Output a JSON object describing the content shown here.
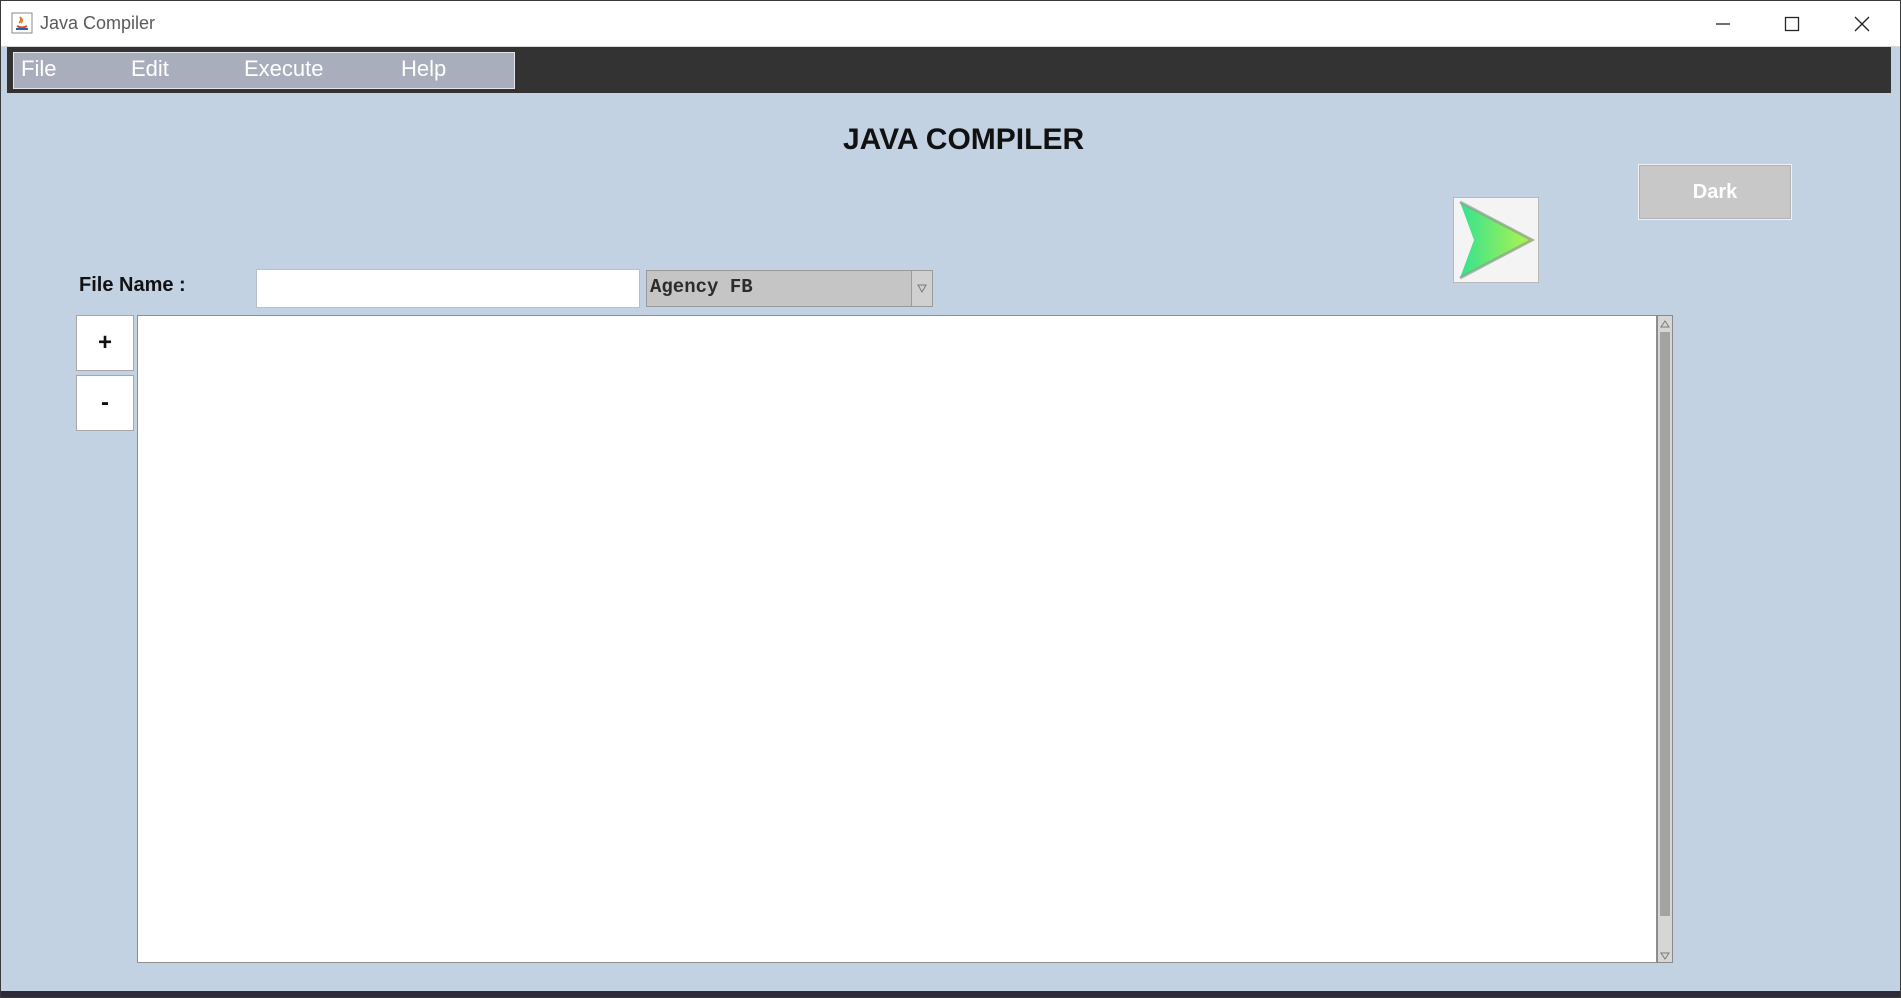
{
  "window": {
    "title": "Java Compiler"
  },
  "menu": {
    "items": [
      "File",
      "Edit",
      "Execute",
      "Help"
    ]
  },
  "header": {
    "title": "JAVA COMPILER"
  },
  "toolbar": {
    "theme_button": "Dark",
    "run_icon": "play-icon"
  },
  "form": {
    "file_label": "File Name :",
    "file_value": "",
    "font_selected": "Agency FB"
  },
  "zoom": {
    "in_label": "+",
    "out_label": "-"
  },
  "editor": {
    "content": ""
  },
  "colors": {
    "background": "#c3d2e2",
    "menu_bg": "#a9aebd",
    "menubar_strip": "#333333",
    "run_gradient_start": "#34e28f",
    "run_gradient_end": "#b7f54a"
  }
}
